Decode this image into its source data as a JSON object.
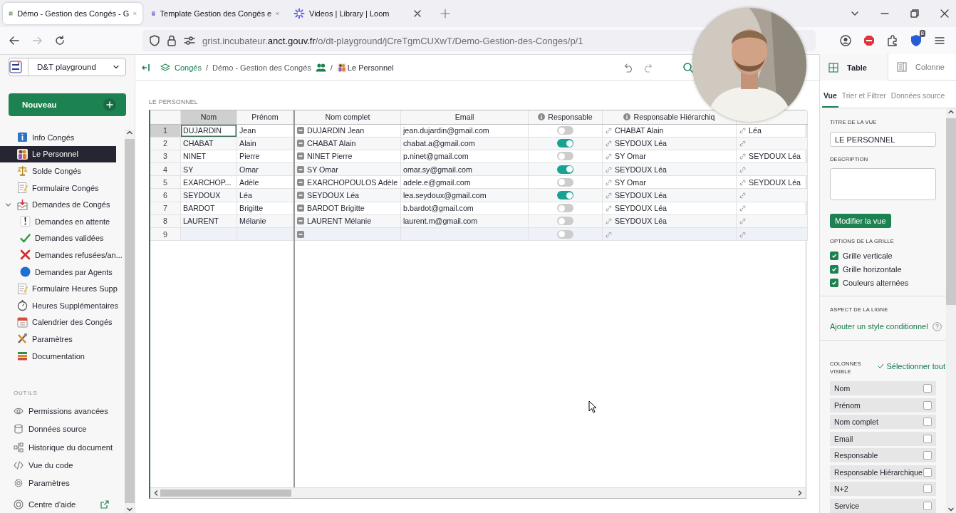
{
  "browser": {
    "tabs": [
      {
        "title": "Démo - Gestion des Congés - G",
        "selected": true
      },
      {
        "title": "Template Gestion des Congés e",
        "selected": false
      },
      {
        "title": "Videos | Library | Loom",
        "selected": false
      }
    ],
    "url": {
      "prefix": "grist.incubateur.",
      "domain": "anct.gouv.fr",
      "path": "/o/dt-playground/jCreTgmCUXwT/Demo-Gestion-des-Conges/p/1"
    },
    "extension_badge": "8"
  },
  "workspace": {
    "name": "D&T playground"
  },
  "breadcrumb": [
    {
      "kind": "link",
      "text": "Congés"
    },
    {
      "kind": "separator",
      "text": "/"
    },
    {
      "kind": "document",
      "text": "Démo - Gestion des Congés"
    },
    {
      "kind": "separator",
      "text": "/"
    },
    {
      "kind": "page",
      "text": "Le Personnel"
    }
  ],
  "sidebar": {
    "new_button": "Nouveau",
    "pages": [
      {
        "label": "Info Congés",
        "selected": false
      },
      {
        "label": "Le Personnel",
        "selected": true
      },
      {
        "label": "Solde Congés",
        "selected": false
      },
      {
        "label": "Formulaire Congés",
        "selected": false
      },
      {
        "label": "Demandes de Congés",
        "selected": false,
        "expanded": true,
        "children": [
          {
            "label": "Demandes en attente",
            "selected": false
          },
          {
            "label": "Demandes validées",
            "selected": false
          },
          {
            "label": "Demandes refusées/an...",
            "selected": false
          },
          {
            "label": "Demandes par Agents",
            "selected": false
          }
        ]
      },
      {
        "label": "Formulaire Heures Supp",
        "selected": false
      },
      {
        "label": "Heures Supplémentaires",
        "selected": false
      },
      {
        "label": "Calendrier des Congés",
        "selected": false
      },
      {
        "label": "Paramètres",
        "selected": false
      },
      {
        "label": "Documentation",
        "selected": false
      }
    ],
    "tools_heading": "OUTILS",
    "tools": [
      {
        "label": "Permissions avancées"
      },
      {
        "label": "Données source"
      },
      {
        "label": "Historique du document"
      },
      {
        "label": "Vue du code"
      },
      {
        "label": "Paramètres"
      }
    ],
    "help": "Centre d'aide"
  },
  "section_title": "LE PERSONNEL",
  "table": {
    "columns": [
      {
        "label": "Nom",
        "kind": "text",
        "selected": true,
        "info": false
      },
      {
        "label": "Prénom",
        "kind": "text",
        "selected": false,
        "info": false
      },
      {
        "label": "Nom complet",
        "kind": "formula",
        "selected": false,
        "info": false
      },
      {
        "label": "Email",
        "kind": "text",
        "selected": false,
        "info": false
      },
      {
        "label": "Responsable",
        "kind": "toggle",
        "selected": false,
        "info": true
      },
      {
        "label": "Responsable Hiérarchiq",
        "kind": "ref",
        "selected": false,
        "info": true
      },
      {
        "kind": "ref"
      }
    ],
    "rows": [
      {
        "number": "1",
        "kind": "record",
        "selected": true,
        "nom": "DUJARDIN",
        "prenom": "Jean",
        "nom_complet": "DUJARDIN Jean",
        "email": "jean.dujardin@gmail.com",
        "responsable": false,
        "responsable_hierarchique": "CHABAT Alain",
        "n2": "Léa"
      },
      {
        "number": "2",
        "kind": "record",
        "selected": false,
        "nom": "CHABAT",
        "prenom": "Alain",
        "nom_complet": "CHABAT Alain",
        "email": "chabat.a@gmail.com",
        "responsable": true,
        "responsable_hierarchique": "SEYDOUX Léa"
      },
      {
        "number": "3",
        "kind": "record",
        "selected": false,
        "nom": "NINET",
        "prenom": "Pierre",
        "nom_complet": "NINET Pierre",
        "email": "p.ninet@gmail.com",
        "responsable": false,
        "responsable_hierarchique": "SY Omar",
        "n2": "SEYDOUX Léa"
      },
      {
        "number": "4",
        "kind": "record",
        "selected": false,
        "nom": "SY",
        "prenom": "Omar",
        "nom_complet": "SY Omar",
        "email": "omar.sy@gmail.com",
        "responsable": true,
        "responsable_hierarchique": "SEYDOUX Léa"
      },
      {
        "number": "5",
        "kind": "record",
        "selected": false,
        "nom": "EXARCHOP...",
        "prenom": "Adèle",
        "nom_complet": "EXARCHOPOULOS Adèle",
        "email": "adele.e@gmail.com",
        "responsable": false,
        "responsable_hierarchique": "SY Omar",
        "n2": "SEYDOUX Léa"
      },
      {
        "number": "6",
        "kind": "record",
        "selected": false,
        "nom": "SEYDOUX",
        "prenom": "Léa",
        "nom_complet": "SEYDOUX Léa",
        "email": "lea.seydoux@gmail.com",
        "responsable": true,
        "responsable_hierarchique": "SEYDOUX Léa"
      },
      {
        "number": "7",
        "kind": "record",
        "selected": false,
        "nom": "BARDOT",
        "prenom": "Brigitte",
        "nom_complet": "BARDOT  Brigitte",
        "email": "b.bardot@gmail.com",
        "responsable": false,
        "responsable_hierarchique": "SEYDOUX Léa"
      },
      {
        "number": "8",
        "kind": "record",
        "selected": false,
        "nom": "LAURENT",
        "prenom": "Mélanie",
        "nom_complet": "LAURENT Mélanie",
        "email": "laurent.m@gmail.com",
        "responsable": false,
        "responsable_hierarchique": "SEYDOUX Léa"
      },
      {
        "number": "9",
        "kind": "add_row",
        "selected": false,
        "responsable": false
      }
    ]
  },
  "right_panel": {
    "tabs": [
      {
        "label": "Table",
        "selected": true
      },
      {
        "label": "Colonne",
        "selected": false
      }
    ],
    "subtabs": [
      {
        "label": "Vue",
        "selected": true
      },
      {
        "label": "Trier et Filtrer",
        "selected": false
      },
      {
        "label": "Données source",
        "selected": false
      }
    ],
    "title_label": "TITRE DE LA VUE",
    "title_value": "LE PERSONNEL",
    "description_label": "DESCRIPTION",
    "edit_button": "Modifier la vue",
    "grid_options_label": "OPTIONS DE LA GRILLE",
    "grid_options": [
      {
        "label": "Grille verticale",
        "checked": true
      },
      {
        "label": "Grille horizontale",
        "checked": true
      },
      {
        "label": "Couleurs alternées",
        "checked": true
      }
    ],
    "row_style_label": "ASPECT DE LA LIGNE",
    "conditional_link": "Ajouter un style conditionnel",
    "visible_columns_label": "COLONNES VISIBLE",
    "select_all": "Sélectionner tout",
    "visible_columns": [
      {
        "label": "Nom",
        "checked": false
      },
      {
        "label": "Prénom",
        "checked": false
      },
      {
        "label": "Nom complet",
        "checked": false
      },
      {
        "label": "Email",
        "checked": false
      },
      {
        "label": "Responsable",
        "checked": false
      },
      {
        "label": "Responsable Hiérarchique",
        "checked": false
      },
      {
        "label": "N+2",
        "checked": false
      },
      {
        "label": "Service",
        "checked": false
      }
    ]
  }
}
